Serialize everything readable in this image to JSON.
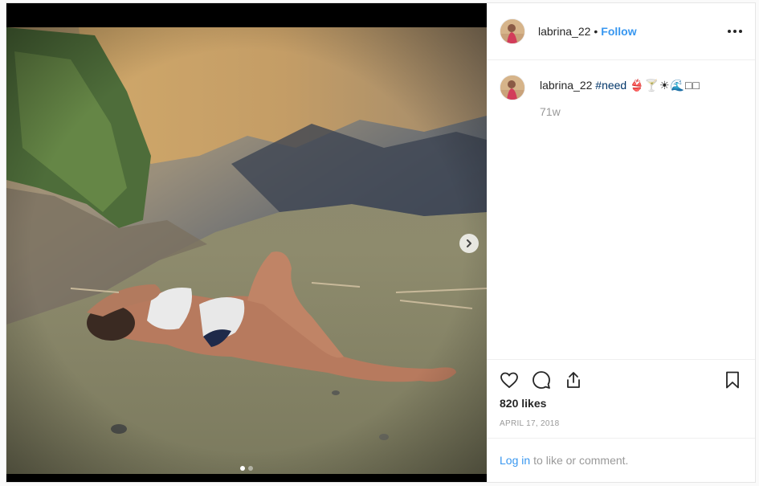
{
  "post": {
    "username": "labrina_22",
    "separator": "•",
    "follow_label": "Follow",
    "more_icon": "more-options-icon",
    "caption": {
      "username": "labrina_22",
      "hashtag": "#need",
      "emojis": "👙🍸☀🌊□□"
    },
    "age": "71w",
    "likes": "820 likes",
    "date": "APRIL 17, 2018",
    "carousel": {
      "current": 1,
      "total": 2
    }
  },
  "actions": {
    "like_icon": "heart-icon",
    "comment_icon": "comment-icon",
    "share_icon": "share-icon",
    "save_icon": "bookmark-icon"
  },
  "login": {
    "link_label": "Log in",
    "rest_label": "to like or comment."
  }
}
